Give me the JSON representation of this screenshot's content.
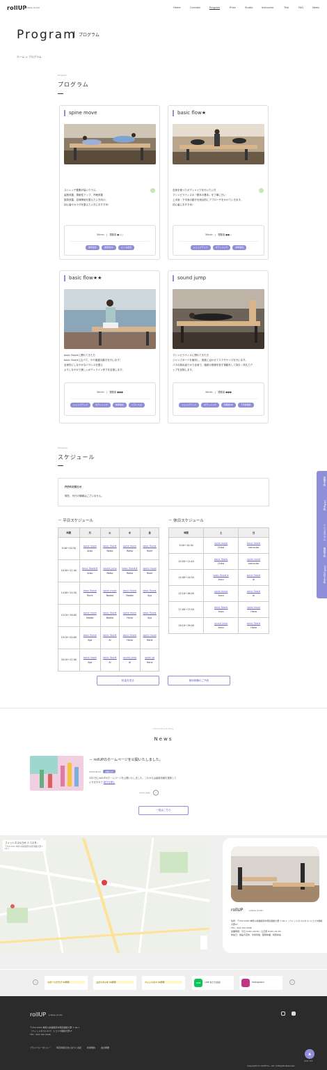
{
  "header": {
    "logo": "rollUP",
    "logo_sub": "pilates studio",
    "nav": [
      "Home",
      "Concept",
      "Program",
      "Price",
      "Studio",
      "Instructor",
      "Trial",
      "FAQ",
      "News"
    ],
    "active": "Program"
  },
  "page": {
    "title": "Program",
    "subtitle": "プログラム",
    "breadcrumb": "ホーム > プログラム"
  },
  "program": {
    "en": "Program",
    "jp": "プログラム",
    "cards": [
      {
        "title": "spine move",
        "desc": [
          "ストレッチ要素が高いクラス。",
          "姿勢改善、柔軟性アップ、不眠改善",
          "猫背改善、自律神経を整えたい方向け。",
          "初心者やカラダを整えたい方におすすめ！"
        ],
        "meta": "50min　|　運動量 ●○○",
        "tags": [
          "姿勢改善",
          "柔軟性UP",
          "むくみ改善"
        ]
      },
      {
        "title": "basic flow★",
        "desc": [
          "全身を使ったボディメイクを行いたい方",
          "マシンピラティスの「基本の基本」を丁寧に行い",
          "上半身・下半身の動きを総合的にアプローチをかけていきます。",
          "初心者におすすめ！"
        ],
        "meta": "50min　|　運動量 ●●○",
        "tags": [
          "シェイプアップ",
          "ボディメイク",
          "体幹強化"
        ]
      },
      {
        "title": "basic flow★★",
        "desc": [
          "basic flow★に慣れてきた方",
          "basic flow★に比べて、やや複雑な動きを行います！",
          "全身的にしなやかなバランスを整え",
          "よりしなやかで美しいボディライン作りを目指します。"
        ],
        "meta": "50min　|　運動量 ●●●",
        "tags": [
          "シェイプアップ",
          "ボディメイク",
          "体幹強化",
          "バランス力"
        ]
      },
      {
        "title": "sound jump",
        "desc": [
          "マシンピラティスに慣れてきた方",
          "ジャンプボードを使用し、音楽に合わせてエクササイズを行います。",
          "パネの跳ね返りから全身で、脂肪の燃焼を促す運動をして持久・持久力アップを目指します。"
        ],
        "meta": "50min　|　運動量 ●●●",
        "tags": [
          "シェイプアップ",
          "ボディメイク",
          "有酸素UP",
          "下半身強化"
        ]
      }
    ]
  },
  "schedule": {
    "en": "Schedule",
    "jp": "スケジュール",
    "notice_title": "代行のお知らせ",
    "notice_text": "現在、代行の情報はございません。",
    "weekday_title": "平日スケジュール",
    "weekday_headers": [
      "時間",
      "月",
      "火",
      "水",
      "金"
    ],
    "weekday_rows": [
      {
        "time": "9:40～10:30",
        "cells": [
          [
            "spine move",
            "Anzu"
          ],
          [
            "basic flow★",
            "Reiko"
          ],
          [
            "spine move",
            "Reiko"
          ],
          [
            "basic flow★",
            "Rumi"
          ]
        ]
      },
      {
        "time": "10:50～11:40",
        "cells": [
          [
            "basic flow★★",
            "Anzu"
          ],
          [
            "sound jump",
            "Reiko"
          ],
          [
            "basic flow★★",
            "Reiko"
          ],
          [
            "spine move",
            "Rumi"
          ]
        ]
      },
      {
        "time": "14:00～14:50",
        "cells": [
          [
            "basic flow★",
            "Rumi"
          ],
          [
            "spine move",
            "Naoko"
          ],
          [
            "basic flow★",
            "Naoko"
          ],
          [
            "basic flow★",
            "Aya"
          ]
        ]
      },
      {
        "time": "15:10～16:00",
        "cells": [
          [
            "spine move",
            "Naoko"
          ],
          [
            "basic flow★",
            "Naoko"
          ],
          [
            "spine move",
            "Hana"
          ],
          [
            "basic flow★",
            "Aya"
          ]
        ]
      },
      {
        "time": "19:10～20:00",
        "cells": [
          [
            "basic flow★",
            "Aya"
          ],
          [
            "basic flow★",
            "Ai"
          ],
          [
            "basic flow★",
            "Hana"
          ],
          [
            "spine move",
            "Hana"
          ]
        ]
      },
      {
        "time": "20:10～21:00",
        "cells": [
          [
            "spine move",
            "Aya"
          ],
          [
            "basic flow★",
            "Ai"
          ],
          [
            "sound jump",
            "Ai"
          ],
          [
            "spine up",
            "Hana"
          ]
        ]
      }
    ],
    "holiday_title": "休日スケジュール",
    "holiday_headers": [
      "時間",
      "土",
      "日"
    ],
    "holiday_rows": [
      {
        "time": "9:40～10:30",
        "cells": [
          [
            "spine move",
            "Chika"
          ],
          [
            "basic flow★",
            "Instructor"
          ]
        ]
      },
      {
        "time": "10:50～11:40",
        "cells": [
          [
            "basic flow★",
            "Chika"
          ],
          [
            "spine move",
            "Instructor"
          ]
        ]
      },
      {
        "time": "14:00～14:50",
        "cells": [
          [
            "basic flow★★",
            "Anzu"
          ],
          [
            "basic flow★",
            "Ai"
          ]
        ]
      },
      {
        "time": "15:10～16:00",
        "cells": [
          [
            "spine move",
            "Anzu"
          ],
          [
            "basic flow★",
            "Ai"
          ]
        ]
      },
      {
        "time": "17:00～17:50",
        "cells": [
          [
            "basic flow★",
            "Anzu"
          ],
          [
            "spine move",
            "Hana"
          ]
        ]
      },
      {
        "time": "18:10～19:00",
        "cells": [
          [
            "sound jump",
            "Anzu"
          ],
          [
            "basic flow★",
            "Hana"
          ]
        ]
      }
    ],
    "btn_price": "料金を見る",
    "btn_trial": "無料体験のご予約"
  },
  "news": {
    "en": "Information & Diary",
    "title": "News",
    "item_title": "rollUPのホームページを公開いたしました。",
    "item_date": "2023.02.01",
    "item_badge": "お知らせ",
    "item_text": "2月1日にrollUPのホームページを公開いたしました。これからは最新情報を更新していきますので",
    "item_more": "続きを読む",
    "read_more": "more view",
    "list_button": "一覧はこちら"
  },
  "side_tab": [
    "体験予約",
    "LINE予約",
    "インスタグラム",
    "電話予約",
    "LINE公式で予約"
  ],
  "access": {
    "map_label": "フィットネス&ヨガ ミコスタ..",
    "map_addr": "〒252-0321 神奈川県相模原市南区相模大野7-16-1",
    "studio_name": "rollUP",
    "studio_sub": "pilates studio",
    "address": "住所：〒252-0303 神奈川県相模原市南区相模大野 7-16-1　(フィットネスルネス) ミコスタ相模大野1F",
    "tel": "TEL：042-702-3006",
    "hours": "営業時間：平日 9:00～22:00 / 土日祝 8:00～21:00",
    "holiday": "休館日：施設不定休、年末年始、臨時休業、特別休館"
  },
  "banners": [
    "スポーツクラブ 33周年",
    "ヨガスタジオ 33周年",
    "フィットネス 33周年",
    "LINE 友だち追加",
    "Instagram"
  ],
  "footer": {
    "logo": "rollUP",
    "logo_sub": "pilates studio",
    "addr1": "〒252-0303 神奈川県相模原市南区相模大野 7-16-1",
    "addr2": "（フィットネスルネス）ミコスタ相模大野1F",
    "tel": "TEL：042-702-3006",
    "links": [
      "プライバシーポリシー",
      "特定商取引法に基づく表記",
      "利用規約",
      "会社概要"
    ],
    "copyright": "Copyright (C) rollUP Co., Ltd. All Rights Reserved.",
    "pagetop": "PAGE TOP"
  },
  "colors": {
    "accent": "#8f8fd9",
    "footer": "#2b2b2b",
    "link": "#5a5acc"
  }
}
